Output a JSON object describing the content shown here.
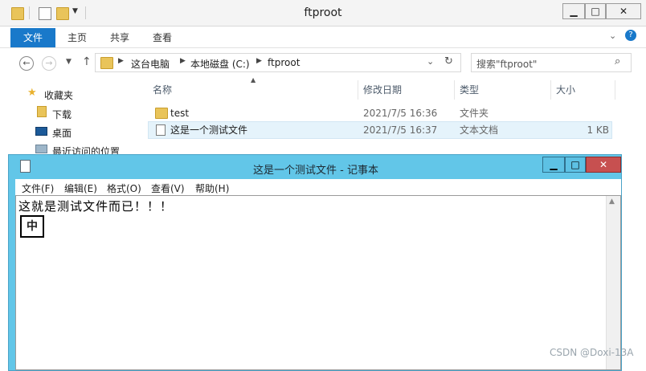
{
  "explorer": {
    "title": "ftproot",
    "tabs": [
      "文件",
      "主页",
      "共享",
      "查看"
    ],
    "breadcrumb": [
      "这台电脑",
      "本地磁盘 (C:)",
      "ftproot"
    ],
    "search_placeholder": "搜索\"ftproot\"",
    "sidebar": {
      "items": [
        "收藏夹",
        "下载",
        "桌面",
        "最近访问的位置"
      ]
    },
    "columns": [
      "名称",
      "修改日期",
      "类型",
      "大小"
    ],
    "files": [
      {
        "name": "test",
        "date": "2021/7/5 16:36",
        "type": "文件夹",
        "size": "",
        "icon": "folder-icon"
      },
      {
        "name": "这是一个测试文件",
        "date": "2021/7/5 16:37",
        "type": "文本文档",
        "size": "1 KB",
        "icon": "text-file-icon"
      }
    ]
  },
  "notepad": {
    "title": "这是一个测试文件 - 记事本",
    "menu": [
      "文件(F)",
      "编辑(E)",
      "格式(O)",
      "查看(V)",
      "帮助(H)"
    ],
    "content": "这就是测试文件而已！！！",
    "ime_indicator": "中"
  },
  "watermark": "CSDN @Doxi-13A",
  "colors": {
    "file_tab": "#1979ca",
    "notepad_frame": "#62c6e8",
    "close_button": "#c75050",
    "selection": "#e5f3fb"
  }
}
